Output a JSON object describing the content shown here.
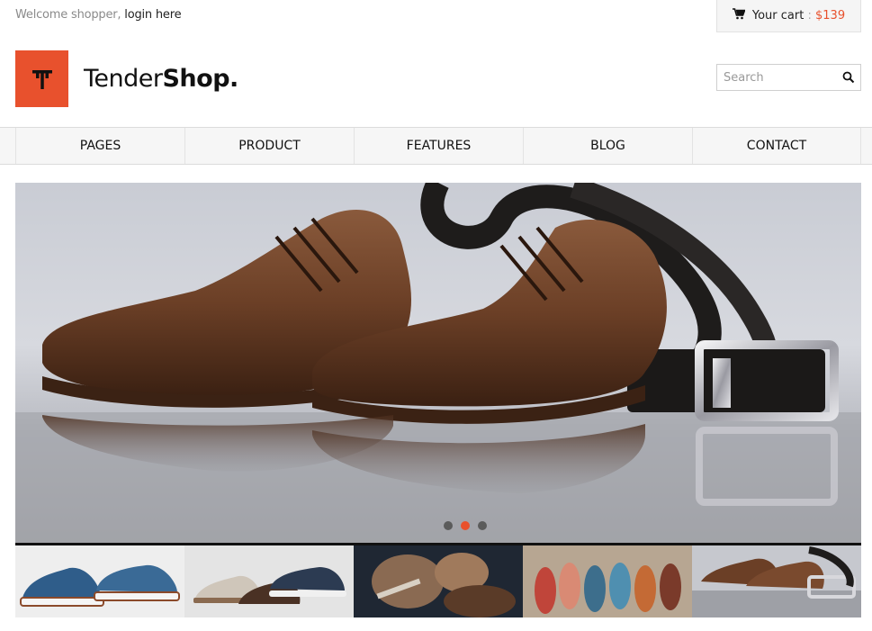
{
  "topbar": {
    "welcome_text": "Welcome shopper,",
    "login_link": "login here",
    "cart_label": "Your cart",
    "cart_separator": ":",
    "cart_amount": "$139"
  },
  "header": {
    "logo_mark": "T",
    "logo_name_regular": "Tender",
    "logo_name_bold": "Shop",
    "logo_name_dot": ".",
    "search_placeholder": "Search"
  },
  "nav": {
    "items": [
      {
        "label": "PAGES"
      },
      {
        "label": "PRODUCT"
      },
      {
        "label": "FEATURES"
      },
      {
        "label": "BLOG"
      },
      {
        "label": "CONTACT"
      }
    ]
  },
  "slider": {
    "active_slide": 2,
    "slide_count": 3,
    "thumbnails": [
      {
        "icon": "sneakers-thumbnail"
      },
      {
        "icon": "casual-shoes-thumbnail"
      },
      {
        "icon": "shoemaker-thumbnail"
      },
      {
        "icon": "colorful-flats-thumbnail"
      },
      {
        "icon": "brown-shoes-belt-thumbnail"
      }
    ]
  },
  "colors": {
    "accent": "#e8512d",
    "nav_bg": "#f6f6f6",
    "text_dark": "#111111",
    "muted": "#8a8a8a"
  }
}
